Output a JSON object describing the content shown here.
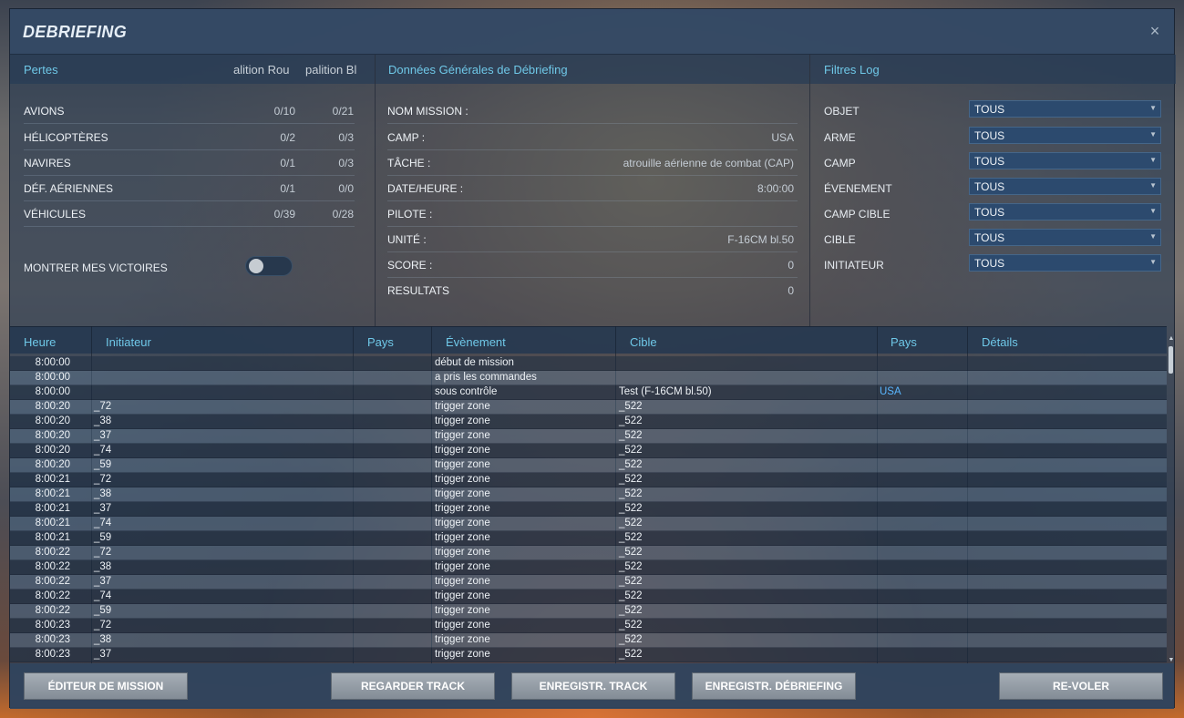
{
  "window": {
    "title": "DEBRIEFING",
    "close_icon": "×"
  },
  "losses": {
    "title": "Pertes",
    "col_red": "alition Rou",
    "col_blue": "palition Bl",
    "rows": [
      {
        "label": "AVIONS",
        "red": "0/10",
        "blue": "0/21"
      },
      {
        "label": "HÉLICOPTÈRES",
        "red": "0/2",
        "blue": "0/3"
      },
      {
        "label": "NAVIRES",
        "red": "0/1",
        "blue": "0/3"
      },
      {
        "label": "DÉF. AÉRIENNES",
        "red": "0/1",
        "blue": "0/0"
      },
      {
        "label": "VÉHICULES",
        "red": "0/39",
        "blue": "0/28"
      }
    ],
    "toggle_label": "MONTRER MES VICTOIRES"
  },
  "general": {
    "title": "Données Générales de Débriefing",
    "rows": [
      {
        "label": "NOM MISSION :",
        "value": ""
      },
      {
        "label": "CAMP :",
        "value": "USA"
      },
      {
        "label": "TÂCHE :",
        "value": "atrouille aérienne de combat (CAP)"
      },
      {
        "label": "DATE/HEURE :",
        "value": "8:00:00"
      },
      {
        "label": "PILOTE :",
        "value": ""
      },
      {
        "label": "UNITÉ :",
        "value": "F-16CM bl.50"
      },
      {
        "label": "SCORE :",
        "value": "0"
      },
      {
        "label": "RESULTATS",
        "value": "0"
      }
    ]
  },
  "filters": {
    "title": "Filtres Log",
    "rows": [
      {
        "label": "OBJET",
        "value": "TOUS"
      },
      {
        "label": "ARME",
        "value": "TOUS"
      },
      {
        "label": "CAMP",
        "value": "TOUS"
      },
      {
        "label": "ÉVENEMENT",
        "value": "TOUS"
      },
      {
        "label": "CAMP CIBLE",
        "value": "TOUS"
      },
      {
        "label": "CIBLE",
        "value": "TOUS"
      },
      {
        "label": "INITIATEUR",
        "value": "TOUS"
      }
    ]
  },
  "log": {
    "columns": [
      "Heure",
      "Initiateur",
      "Pays",
      "Évènement",
      "Cible",
      "Pays",
      "Détails"
    ],
    "rows": [
      {
        "time": "8:00:00",
        "initiator": "",
        "event": "début de mission",
        "target": "",
        "country": ""
      },
      {
        "time": "8:00:00",
        "initiator": "",
        "event": "a pris les commandes",
        "target": "",
        "country": ""
      },
      {
        "time": "8:00:00",
        "initiator": "",
        "event": "sous contrôle",
        "target": "Test (F-16CM bl.50)",
        "country": "USA"
      },
      {
        "time": "8:00:20",
        "initiator": "_72",
        "event": "trigger zone",
        "target": "_522",
        "country": ""
      },
      {
        "time": "8:00:20",
        "initiator": "_38",
        "event": "trigger zone",
        "target": "_522",
        "country": ""
      },
      {
        "time": "8:00:20",
        "initiator": "_37",
        "event": "trigger zone",
        "target": "_522",
        "country": ""
      },
      {
        "time": "8:00:20",
        "initiator": "_74",
        "event": "trigger zone",
        "target": "_522",
        "country": ""
      },
      {
        "time": "8:00:20",
        "initiator": "_59",
        "event": "trigger zone",
        "target": "_522",
        "country": ""
      },
      {
        "time": "8:00:21",
        "initiator": "_72",
        "event": "trigger zone",
        "target": "_522",
        "country": ""
      },
      {
        "time": "8:00:21",
        "initiator": "_38",
        "event": "trigger zone",
        "target": "_522",
        "country": ""
      },
      {
        "time": "8:00:21",
        "initiator": "_37",
        "event": "trigger zone",
        "target": "_522",
        "country": ""
      },
      {
        "time": "8:00:21",
        "initiator": "_74",
        "event": "trigger zone",
        "target": "_522",
        "country": ""
      },
      {
        "time": "8:00:21",
        "initiator": "_59",
        "event": "trigger zone",
        "target": "_522",
        "country": ""
      },
      {
        "time": "8:00:22",
        "initiator": "_72",
        "event": "trigger zone",
        "target": "_522",
        "country": ""
      },
      {
        "time": "8:00:22",
        "initiator": "_38",
        "event": "trigger zone",
        "target": "_522",
        "country": ""
      },
      {
        "time": "8:00:22",
        "initiator": "_37",
        "event": "trigger zone",
        "target": "_522",
        "country": ""
      },
      {
        "time": "8:00:22",
        "initiator": "_74",
        "event": "trigger zone",
        "target": "_522",
        "country": ""
      },
      {
        "time": "8:00:22",
        "initiator": "_59",
        "event": "trigger zone",
        "target": "_522",
        "country": ""
      },
      {
        "time": "8:00:23",
        "initiator": "_72",
        "event": "trigger zone",
        "target": "_522",
        "country": ""
      },
      {
        "time": "8:00:23",
        "initiator": "_38",
        "event": "trigger zone",
        "target": "_522",
        "country": ""
      },
      {
        "time": "8:00:23",
        "initiator": "_37",
        "event": "trigger zone",
        "target": "_522",
        "country": ""
      }
    ]
  },
  "buttons": {
    "mission_editor": "ÉDITEUR DE MISSION",
    "watch_track": "REGARDER TRACK",
    "save_track": "ENREGISTR. TRACK",
    "save_debriefing": "ENREGISTR. DÉBRIEFING",
    "refly": "RE-VOLER"
  },
  "colors": {
    "accent": "#6fc8e8",
    "country_link": "#5ab6ff",
    "panel": "#344a66",
    "button": "#8f98a2"
  },
  "icons": {
    "close": "close-icon",
    "dropdown": "chevron-down-icon",
    "scroll_up": "scroll-up-icon",
    "scroll_down": "scroll-down-icon"
  }
}
